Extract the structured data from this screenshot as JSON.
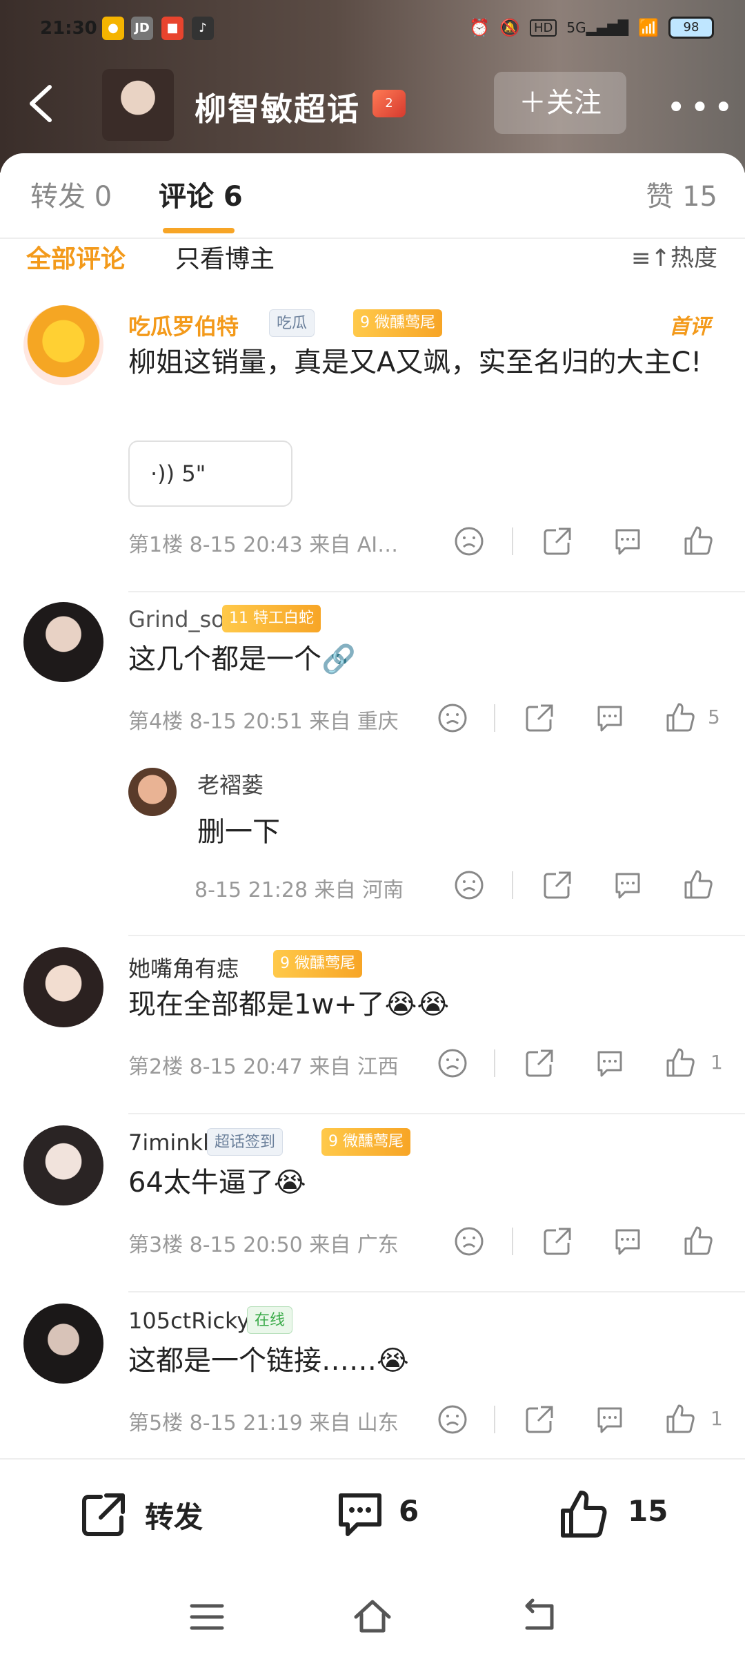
{
  "status_bar": {
    "time": "21:30",
    "battery": "98",
    "right_icons": [
      "alarm-icon",
      "mute-icon",
      "hd-icon",
      "5g-signal-icon",
      "wifi-icon"
    ]
  },
  "header": {
    "title": "柳智敏超话",
    "badge": "2",
    "follow_label": "＋关注",
    "more": "•••"
  },
  "tabs": [
    {
      "label": "转发 0"
    },
    {
      "label": "评论 6"
    },
    {
      "label": "赞 15"
    }
  ],
  "filters": {
    "all": "全部评论",
    "author_only": "只看博主",
    "sort": "热度"
  },
  "comments": [
    {
      "user": "吃瓜罗伯特",
      "tag1": "吃瓜",
      "tag2": "9 微醺莺尾",
      "first_label": "首评",
      "text": "柳姐这销量，真是又A又飒，实至名归的大主C!",
      "voice": "5\"",
      "meta": "第1楼  8-15 20:43  来自 AI…",
      "likes": ""
    },
    {
      "user": "Grind_so",
      "tag1": "11 特工白蛇",
      "text": "这几个都是一个🔗",
      "meta": "第4楼  8-15 20:51  来自 重庆",
      "likes": "5",
      "reply": {
        "user": "老褶蒌",
        "text": "删一下",
        "meta": "8-15 21:28  来自 河南"
      }
    },
    {
      "user": "她嘴角有痣",
      "tag1": "9 微醺莺尾",
      "text": "现在全部都是1w+了😭😭",
      "meta": "第2楼  8-15 20:47  来自 江西",
      "likes": "1"
    },
    {
      "user": "7iminkk",
      "tag1": "超话签到",
      "tag2": "9 微醺莺尾",
      "text": "64太牛逼了😭",
      "meta": "第3楼  8-15 20:50  来自 广东",
      "likes": ""
    },
    {
      "user": "105ctRicky",
      "tag1": "在线",
      "text": "这都是一个链接……😭",
      "meta": "第5楼  8-15 21:19  来自 山东",
      "likes": "1"
    }
  ],
  "bottom_bar": {
    "repost": "转发",
    "comments": "6",
    "likes": "15"
  }
}
